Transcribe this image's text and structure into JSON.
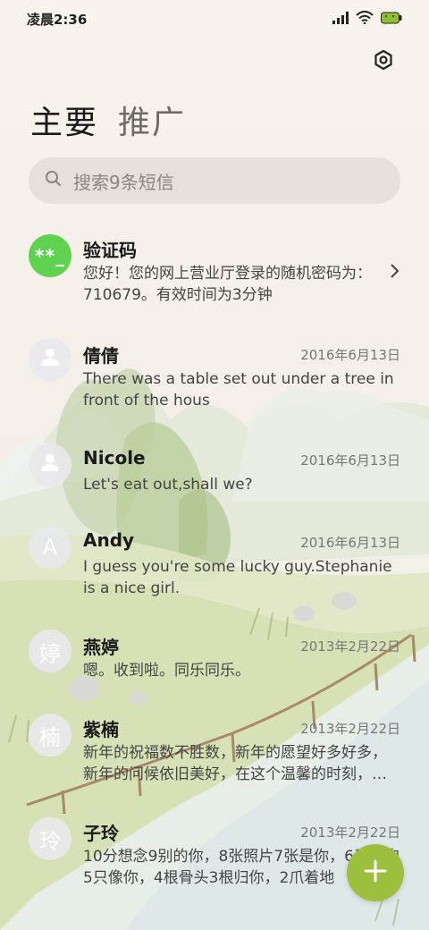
{
  "status_bar": {
    "time": "凌晨2:36",
    "icons": [
      "signal-icon",
      "wifi-icon",
      "battery-icon"
    ]
  },
  "header": {
    "settings_icon": "gear-icon",
    "tabs": [
      {
        "label": "主要",
        "active": true
      },
      {
        "label": "推广",
        "active": false
      }
    ]
  },
  "search": {
    "placeholder": "搜索9条短信",
    "icon": "search-icon"
  },
  "messages": [
    {
      "avatar_text": "**_",
      "avatar_color": "#5fd34f",
      "name": "验证码",
      "date": "",
      "preview": "您好！您的网上营业厅登录的随机密码为：710679。有效时间为3分钟",
      "has_chevron": true
    },
    {
      "avatar_text": "",
      "avatar_icon": "person-icon",
      "name": "倩倩",
      "date": "2016年6月13日",
      "preview": "There was a table set out under a tree in front of the hous"
    },
    {
      "avatar_text": "",
      "avatar_icon": "person-icon",
      "name": "Nicole",
      "date": "2016年6月13日",
      "preview": "Let's eat out,shall we?"
    },
    {
      "avatar_text": "A",
      "name": "Andy",
      "date": "2016年6月13日",
      "preview": "I guess you're some lucky guy.Stephanie is a nice girl."
    },
    {
      "avatar_text": "婷",
      "name": "燕婷",
      "date": "2013年2月22日",
      "preview": "嗯。收到啦。同乐同乐。"
    },
    {
      "avatar_text": "楠",
      "name": "紫楠",
      "date": "2013年2月22日",
      "preview": "新年的祝福数不胜数，新年的愿望好多好多，新年的问候依旧美好，在这个温馨的时刻，…"
    },
    {
      "avatar_text": "玲",
      "name": "子玲",
      "date": "2013年2月22日",
      "preview": "10分想念9别的你，8张照片7张是你，6只小狗5只像你，4根骨头3根归你，2爪着地"
    }
  ],
  "fab": {
    "icon": "plus-icon",
    "color": "#9cbf3e"
  }
}
